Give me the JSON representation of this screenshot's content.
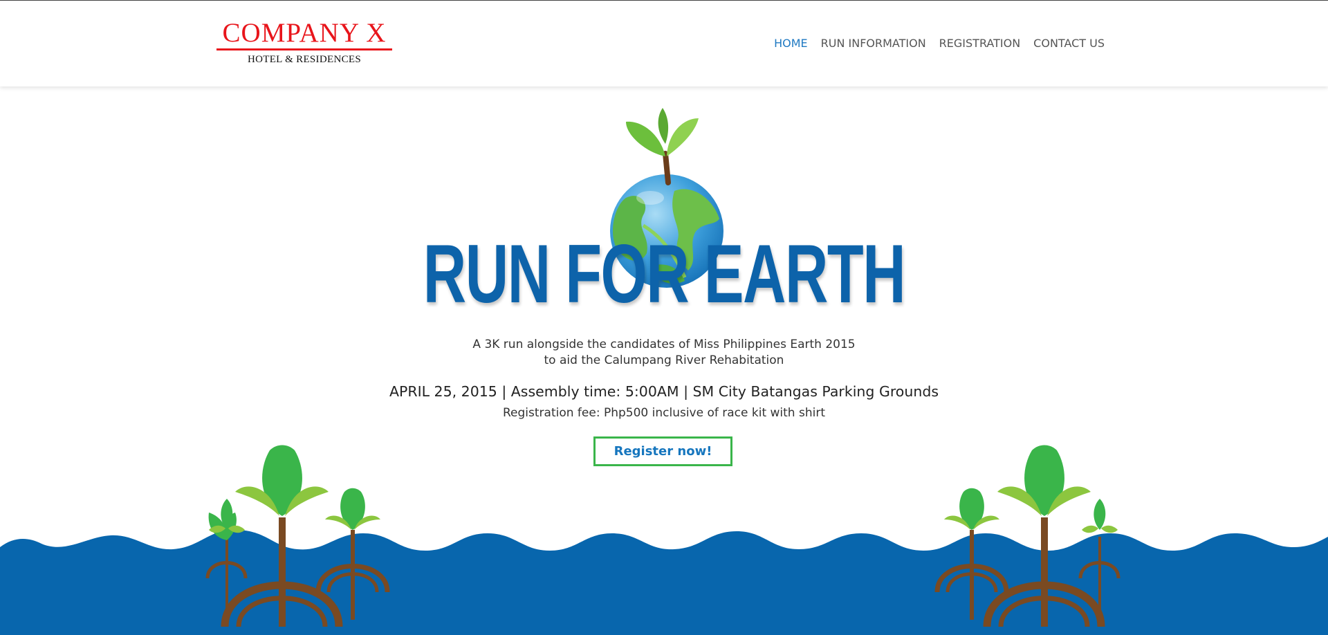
{
  "header": {
    "logo": {
      "name": "COMPANY X",
      "tagline": "HOTEL & RESIDENCES"
    },
    "nav": [
      {
        "label": "HOME",
        "active": true
      },
      {
        "label": "RUN INFORMATION",
        "active": false
      },
      {
        "label": "REGISTRATION",
        "active": false
      },
      {
        "label": "CONTACT US",
        "active": false
      }
    ]
  },
  "hero": {
    "title": "RUN FOR EARTH",
    "description_line1": "A 3K run alongside the candidates of Miss Philippines Earth 2015",
    "description_line2": "to aid the Calumpang River Rehabitation",
    "details": "APRIL 25, 2015 | Assembly time: 5:00AM | SM City Batangas Parking Grounds",
    "fee": "Registration fee: Php500 inclusive of race kit with shirt",
    "cta_label": "Register now!"
  },
  "colors": {
    "brand_red": "#e8151b",
    "nav_active": "#1f79c2",
    "title_blue": "#0d63aa",
    "water_blue": "#0866ad",
    "cta_border": "#3ab54a",
    "leaf_green": "#3ab54a",
    "leaf_light": "#8cc63f",
    "trunk_brown": "#7a4a22"
  },
  "icons": [
    "earth-globe-icon",
    "sprout-icon",
    "mangrove-tree-icon",
    "water-waves-icon"
  ]
}
